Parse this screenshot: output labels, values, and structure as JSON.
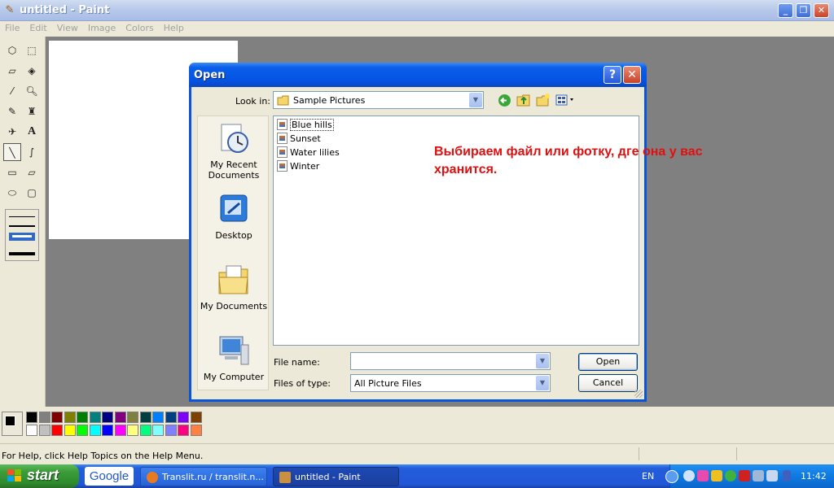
{
  "window": {
    "title": "untitled - Paint",
    "min_icon": "minimize-icon",
    "max_icon": "restore-icon",
    "close_icon": "close-icon"
  },
  "menu": [
    "File",
    "Edit",
    "View",
    "Image",
    "Colors",
    "Help"
  ],
  "status": {
    "text": "For Help, click Help Topics on the Help Menu."
  },
  "dialog": {
    "title": "Open",
    "help_label": "?",
    "close_label": "✕",
    "look_in_label": "Look in:",
    "look_in_value": "Sample Pictures",
    "places": [
      "My Recent Documents",
      "Desktop",
      "My Documents",
      "My Computer"
    ],
    "files": [
      "Blue hills",
      "Sunset",
      "Water lilies",
      "Winter"
    ],
    "file_name_label": "File name:",
    "file_name_value": "",
    "file_type_label": "Files of type:",
    "file_type_value": "All Picture Files",
    "open_label": "Open",
    "cancel_label": "Cancel"
  },
  "annotation": {
    "line1": "Выбираем файл или фотку, дге она у вас",
    "line2": "хранится."
  },
  "palette": [
    "#000000",
    "#808080",
    "#800000",
    "#808000",
    "#008000",
    "#008080",
    "#000080",
    "#800080",
    "#808040",
    "#004040",
    "#0080ff",
    "#004080",
    "#8000ff",
    "#804000",
    "#ffffff",
    "#c0c0c0",
    "#ff0000",
    "#ffff00",
    "#00ff00",
    "#00ffff",
    "#0000ff",
    "#ff00ff",
    "#ffff80",
    "#00ff80",
    "#80ffff",
    "#8080ff",
    "#ff0080",
    "#ff8040"
  ],
  "taskbar": {
    "start_label": "start",
    "google_label": "Google",
    "tasks": [
      "Translit.ru / translit.n...",
      "untitled - Paint"
    ],
    "lang": "EN",
    "clock": "11:42"
  }
}
